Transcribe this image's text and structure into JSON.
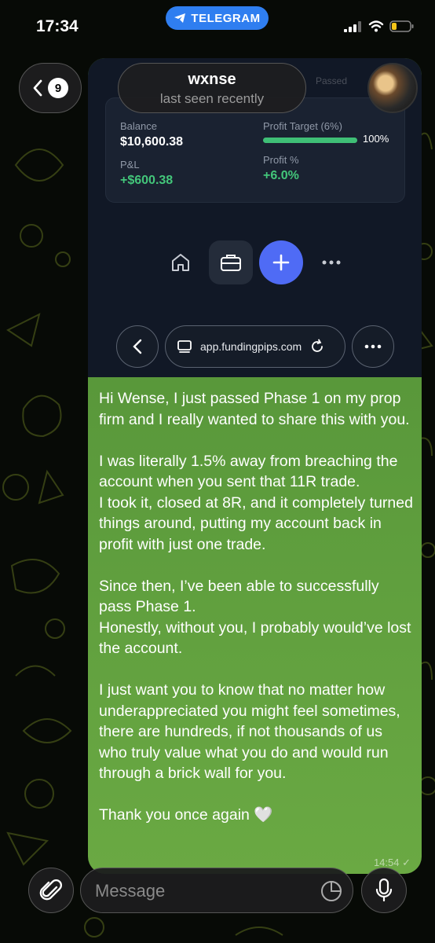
{
  "status_bar": {
    "time": "17:34",
    "app_pill": "TELEGRAM"
  },
  "header": {
    "back_badge": "9",
    "chat_name": "wxnse",
    "chat_status": "last seen recently"
  },
  "screenshot": {
    "faded_tag": "Passed",
    "balance_label": "Balance",
    "balance_value": "$10,600.38",
    "pnl_label": "P&L",
    "pnl_value": "+$600.38",
    "target_label": "Profit Target (6%)",
    "target_progress": 1.0,
    "target_pct": "100%",
    "profit_label": "Profit %",
    "profit_value": "+6.0%",
    "url": "app.fundingpips.com"
  },
  "message": {
    "text": "Hi Wense, I just passed Phase 1 on my prop firm and I really wanted to share this with you.\n\nI was literally 1.5% away from breaching the account when you sent that 11R trade.\nI took it, closed at 8R, and it completely turned things around, putting my account back in profit with just one trade.\n\nSince then, I’ve been able to successfully pass Phase 1.\nHonestly, without you, I probably would’ve lost the account.\n\nI just want you to know that no matter how underappreciated you might feel sometimes, there are hundreds, if not thousands of us who truly value what you do and would run through a brick wall for you.\n\nThank you once again 🤍",
    "time": "14:54 ✓"
  },
  "input": {
    "placeholder": "Message"
  },
  "colors": {
    "bubble": "#5c9b3c",
    "telegram_blue": "#2f7ef0",
    "profit_green": "#43c67a",
    "plus_button": "#4f6bf5"
  }
}
